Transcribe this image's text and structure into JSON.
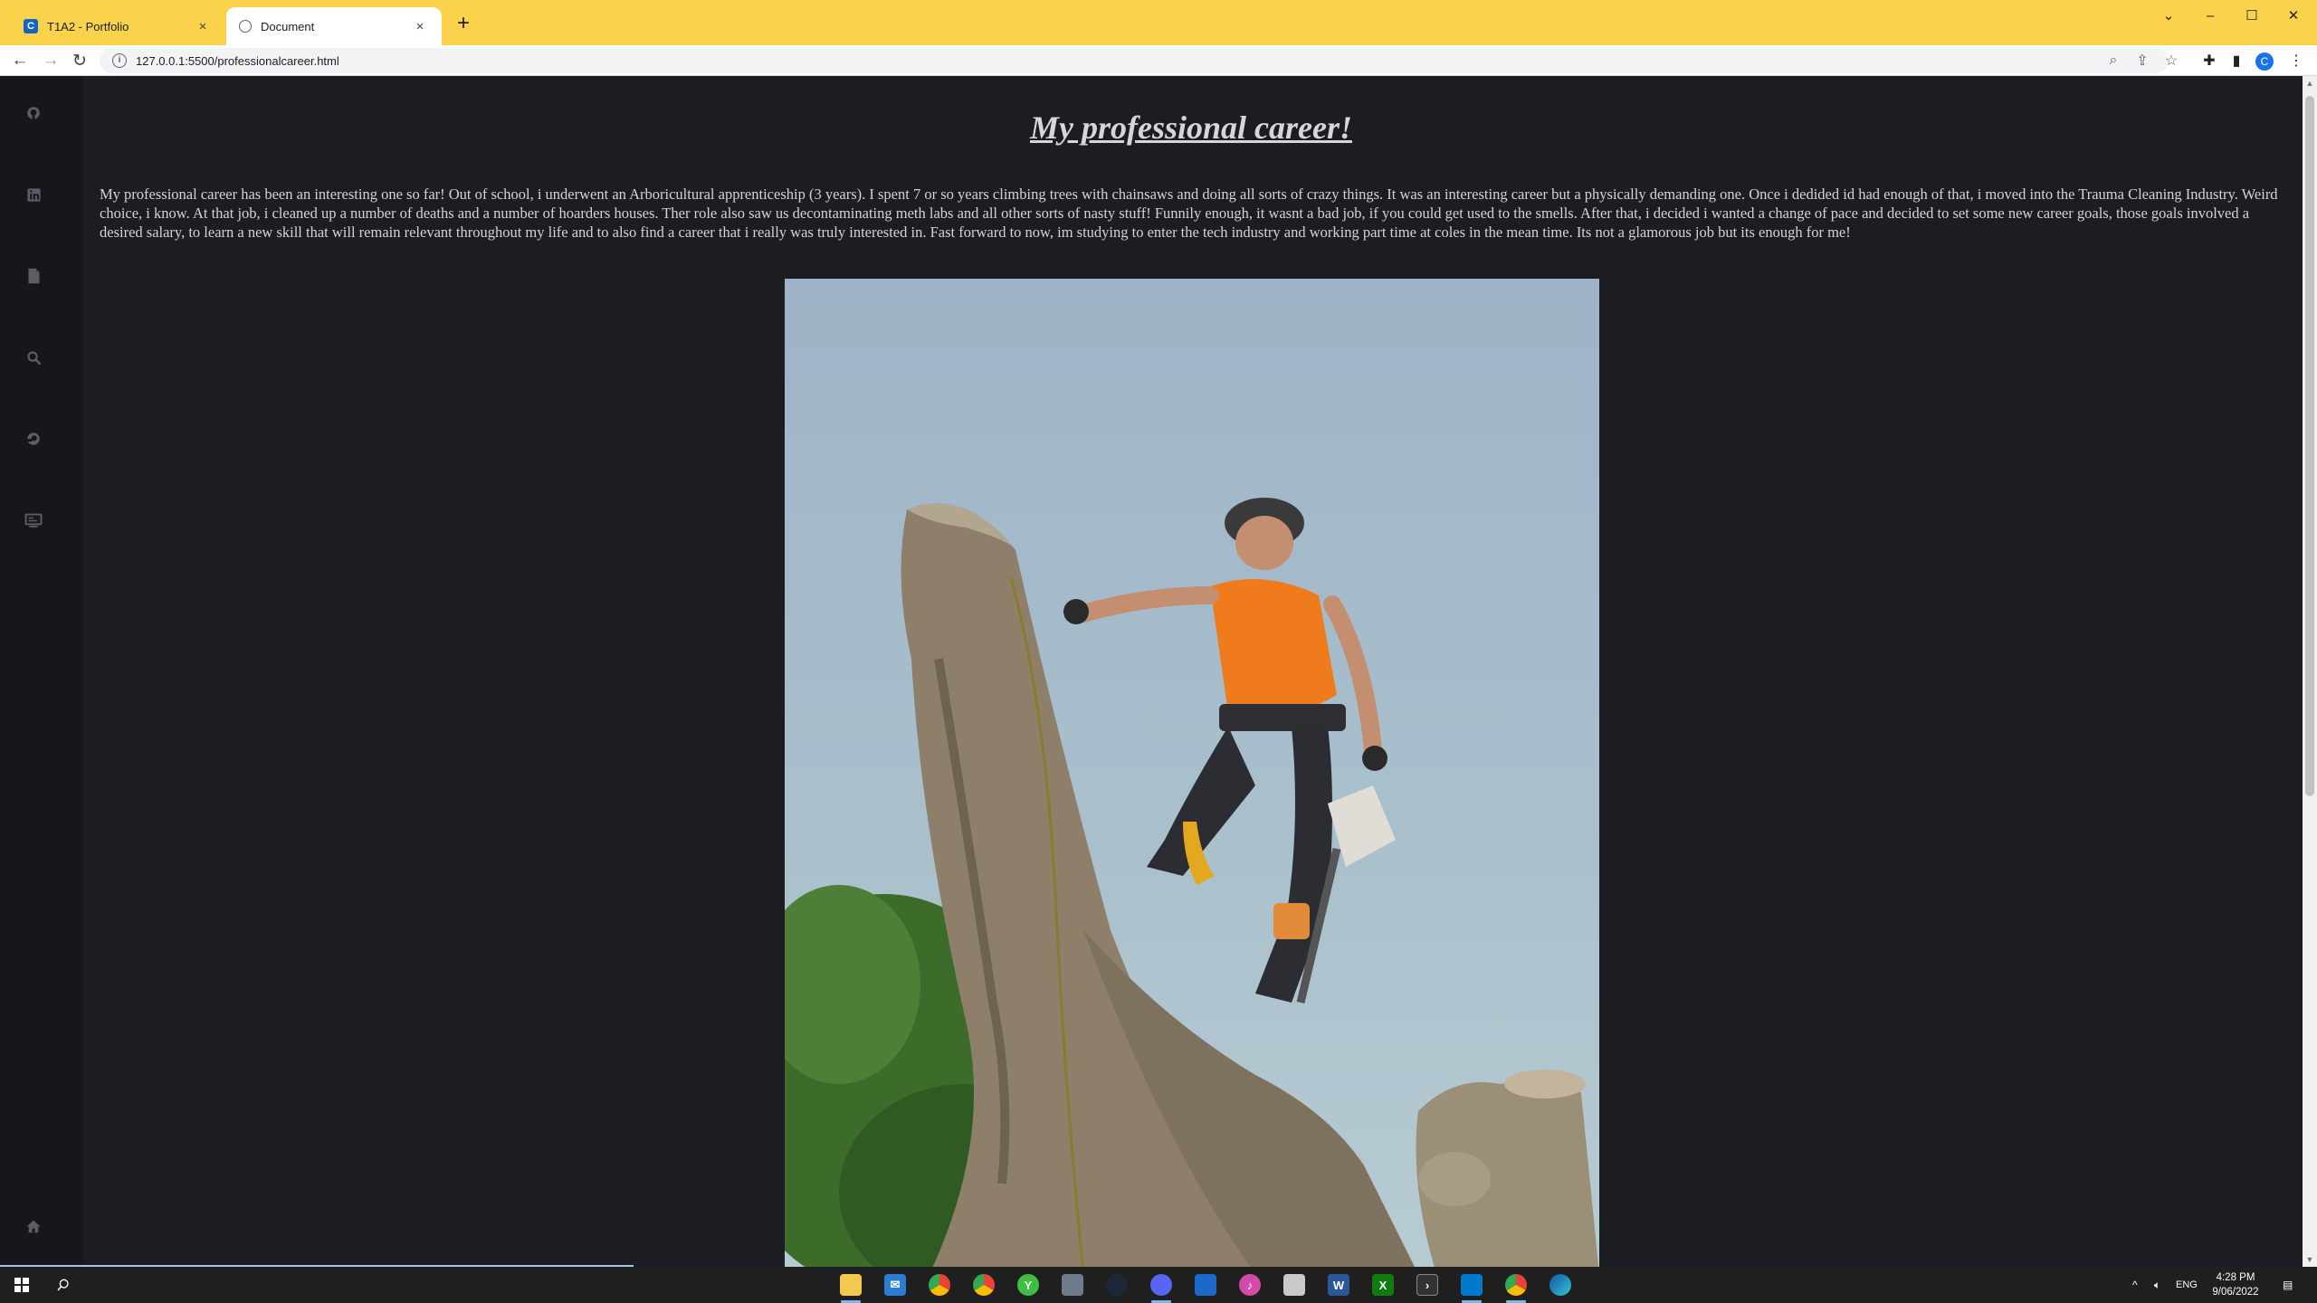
{
  "browser": {
    "tabs": [
      {
        "title": "T1A2 - Portfolio",
        "close": "×"
      },
      {
        "title": "Document",
        "close": "×"
      }
    ],
    "new_tab": "+",
    "url": "127.0.0.1:5500/professionalcareer.html",
    "profile_initial": "C",
    "theme_color": "#fad24b"
  },
  "sidebar": {
    "items": [
      "github-icon",
      "linkedin-icon",
      "document-icon",
      "search-icon",
      "history-icon",
      "projects-icon"
    ],
    "bottom_item": "home-icon"
  },
  "page": {
    "title": "My professional career!",
    "paragraph": "My professional career has been an interesting one so far! Out of school, i underwent an Arboricultural apprenticeship (3 years). I spent 7 or so years climbing trees with chainsaws and doing all sorts of crazy things. It was an interesting career but a physically demanding one. Once i dedided id had enough of that, i moved into the Trauma Cleaning Industry. Weird choice, i know. At that job, i cleaned up a number of deaths and a number of hoarders houses. Ther role also saw us decontaminating meth labs and all other sorts of nasty stuff! Funnily enough, it wasnt a bad job, if you could get used to the smells. After that, i decided i wanted a change of pace and decided to set some new career goals, those goals involved a desired salary, to learn a new skill that will remain relevant throughout my life and to also find a career that i really was truly interested in. Fast forward to now, im studying to enter the tech industry and working part time at coles in the mean time. Its not a glamorous job but its enough for me!",
    "background_color": "#1c1d23"
  },
  "taskbar": {
    "language": "ENG",
    "time": "4:28 PM",
    "date": "9/06/2022"
  }
}
